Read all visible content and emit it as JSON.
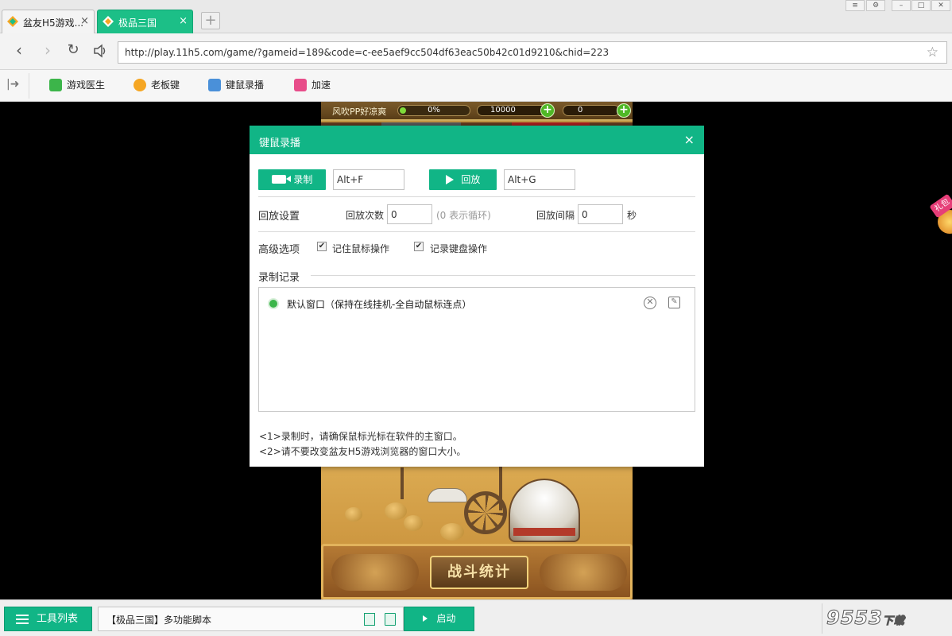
{
  "tabs": [
    {
      "label": "盆友H5游戏...",
      "active": false
    },
    {
      "label": "极品三国",
      "active": true
    }
  ],
  "tab_close_glyph": "×",
  "new_tab_glyph": "+",
  "address_bar": {
    "url": "http://play.11h5.com/game/?gameid=189&code=c-ee5aef9cc504df63eac50b42c01d9210&chid=223"
  },
  "toolbar": {
    "items": [
      {
        "label": "游戏医生",
        "icon": "medkit-icon",
        "color": "#3cb54a"
      },
      {
        "label": "老板键",
        "icon": "eye-icon",
        "color": "#f5a623"
      },
      {
        "label": "键鼠录播",
        "icon": "keyboard-icon",
        "color": "#4a90d9"
      },
      {
        "label": "加速",
        "icon": "gamepad-icon",
        "color": "#e84d8a"
      }
    ]
  },
  "game": {
    "player_name": "风吹PP好凉爽",
    "exp_percent": "0%",
    "coins": "10000",
    "gold": "0",
    "battle_button": "战斗统计",
    "gift_badge": "礼包"
  },
  "dialog": {
    "title": "键鼠录播",
    "close": "×",
    "record_button": "录制",
    "record_hotkey": "Alt+F",
    "play_button": "回放",
    "play_hotkey": "Alt+G",
    "playback_settings_label": "回放设置",
    "playback_count_label": "回放次数",
    "playback_count_value": "0",
    "playback_count_hint": "(0 表示循环)",
    "playback_interval_label": "回放间隔",
    "playback_interval_value": "0",
    "playback_interval_unit": "秒",
    "advanced_label": "高级选项",
    "option_mouse_label": "记住鼠标操作",
    "option_mouse_checked": true,
    "option_keyboard_label": "记录键盘操作",
    "option_keyboard_checked": true,
    "records_label": "录制记录",
    "records": [
      {
        "text": "默认窗口（保持在线挂机-全自动鼠标连点）"
      }
    ],
    "notes": [
      "<1>录制时，请确保鼠标光标在软件的主窗口。",
      "<2>请不要改变盆友H5游戏浏览器的窗口大小。"
    ]
  },
  "bottom_bar": {
    "tool_list_label": "工具列表",
    "script_label": "【极品三国】多功能脚本",
    "start_label": "启动",
    "watermark": "9553",
    "watermark_sub": "下载"
  },
  "colors": {
    "accent": "#11b586",
    "game_bg": "#000000"
  }
}
